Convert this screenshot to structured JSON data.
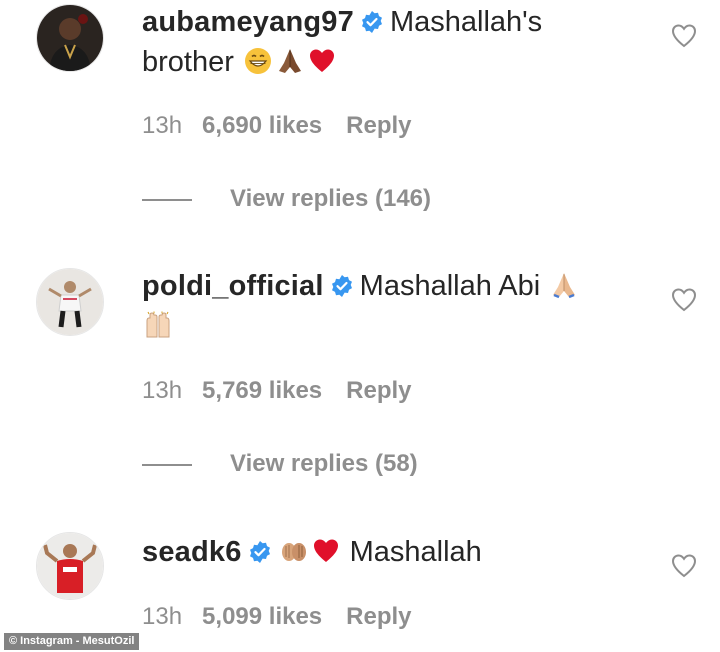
{
  "comments": [
    {
      "username": "aubameyang97",
      "text_line1": "Mashallah's",
      "text_line2": "brother",
      "emojis": [
        "grinning-face",
        "folded-hands-dark",
        "red-heart"
      ],
      "time": "13h",
      "likes": "6,690 likes",
      "reply": "Reply",
      "view_replies": "View replies (146)"
    },
    {
      "username": "poldi_official",
      "text_line1": "Mashallah Abi",
      "emojis": [
        "folded-hands-light",
        "raised-hands-light"
      ],
      "time": "13h",
      "likes": "5,769 likes",
      "reply": "Reply",
      "view_replies": "View replies (58)"
    },
    {
      "username": "seadk6",
      "text_line1": "Mashallah",
      "emojis": [
        "clapping-hands-medium",
        "red-heart"
      ],
      "time": "13h",
      "likes": "5,099 likes",
      "reply": "Reply"
    }
  ],
  "colors": {
    "text": "#262626",
    "muted": "#8e8e8e",
    "verified": "#3897f0",
    "heart": "#e0102a"
  },
  "credit": "© Instagram - MesutOzil"
}
